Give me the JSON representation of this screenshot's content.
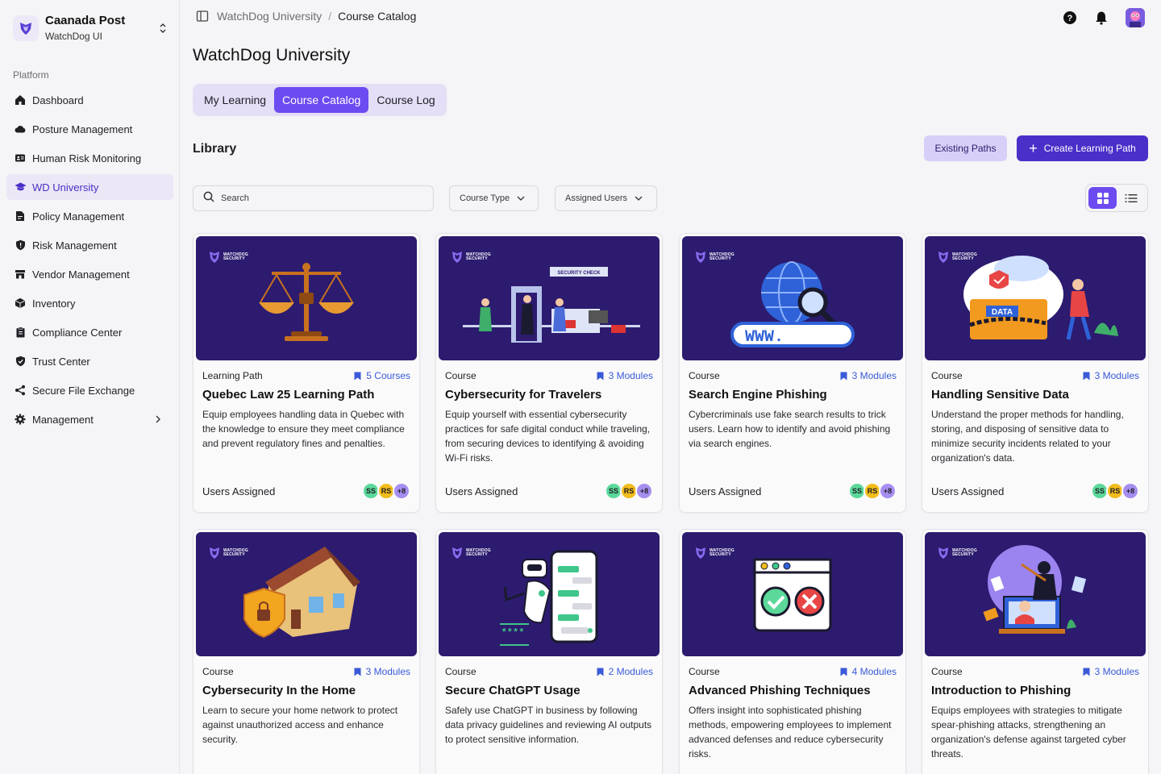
{
  "org": {
    "name": "Caanada Post",
    "subtitle": "WatchDog UI"
  },
  "sidebar": {
    "section": "Platform",
    "items": [
      {
        "label": "Dashboard",
        "icon": "home-icon"
      },
      {
        "label": "Posture Management",
        "icon": "cloud-icon"
      },
      {
        "label": "Human Risk Monitoring",
        "icon": "id-card-icon"
      },
      {
        "label": "WD University",
        "icon": "graduation-cap-icon",
        "active": true
      },
      {
        "label": "Policy Management",
        "icon": "file-icon"
      },
      {
        "label": "Risk Management",
        "icon": "shield-icon"
      },
      {
        "label": "Vendor Management",
        "icon": "store-icon"
      },
      {
        "label": "Inventory",
        "icon": "cube-icon"
      },
      {
        "label": "Compliance Center",
        "icon": "clipboard-icon"
      },
      {
        "label": "Trust Center",
        "icon": "shield-check-icon"
      },
      {
        "label": "Secure File Exchange",
        "icon": "share-icon"
      },
      {
        "label": "Management",
        "icon": "gear-icon"
      }
    ]
  },
  "breadcrumb": {
    "parent": "WatchDog University",
    "current": "Course Catalog"
  },
  "page": {
    "title": "WatchDog University"
  },
  "tabs": [
    "My Learning",
    "Course Catalog",
    "Course Log"
  ],
  "library": {
    "title": "Library",
    "existing_paths": "Existing Paths",
    "create_path": "Create Learning Path",
    "search_placeholder": "Search",
    "filter_course_type": "Course Type",
    "filter_assigned_users": "Assigned Users"
  },
  "brand_text": [
    "WATCHDOG",
    "SECURITY"
  ],
  "cards": [
    {
      "type": "Learning Path",
      "modules": "5 Courses",
      "title": "Quebec Law 25 Learning Path",
      "desc": "Equip employees handling data in Quebec with the knowledge to ensure they meet compliance and prevent regulatory fines and penalties.",
      "users_label": "Users Assigned",
      "chips": [
        "SS",
        "RS",
        "+8"
      ]
    },
    {
      "type": "Course",
      "modules": "3 Modules",
      "title": "Cybersecurity for Travelers",
      "desc": "Equip yourself with essential cybersecurity practices for safe digital conduct while traveling, from securing devices to identifying & avoiding Wi-Fi risks.",
      "users_label": "Users Assigned",
      "chips": [
        "SS",
        "RS",
        "+8"
      ],
      "image_text": "SECURITY CHECK"
    },
    {
      "type": "Course",
      "modules": "3 Modules",
      "title": "Search Engine Phishing",
      "desc": "Cybercriminals use fake search results to trick users. Learn how to identify and avoid phishing via search engines.",
      "users_label": "Users Assigned",
      "chips": [
        "SS",
        "RS",
        "+8"
      ],
      "image_text": "WWW."
    },
    {
      "type": "Course",
      "modules": "3 Modules",
      "title": "Handling Sensitive Data",
      "desc": "Understand the proper methods for handling, storing, and disposing of sensitive data to minimize security incidents related to your organization's data.",
      "users_label": "Users Assigned",
      "chips": [
        "SS",
        "RS",
        "+8"
      ],
      "image_text": "DATA"
    },
    {
      "type": "Course",
      "modules": "3 Modules",
      "title": "Cybersecurity In the Home",
      "desc": "Learn to secure your home network to protect against unauthorized access and enhance security."
    },
    {
      "type": "Course",
      "modules": "2 Modules",
      "title": "Secure ChatGPT Usage",
      "desc": "Safely use ChatGPT in business by following data privacy guidelines and reviewing AI outputs to protect sensitive information.",
      "image_text": "****"
    },
    {
      "type": "Course",
      "modules": "4 Modules",
      "title": "Advanced Phishing Techniques",
      "desc": "Offers insight into sophisticated phishing methods, empowering employees to implement advanced defenses and reduce cybersecurity risks."
    },
    {
      "type": "Course",
      "modules": "3 Modules",
      "title": "Introduction to Phishing",
      "desc": "Equips employees with strategies to mitigate spear-phishing attacks, strengthening an organization's defense against targeted cyber threats."
    }
  ]
}
